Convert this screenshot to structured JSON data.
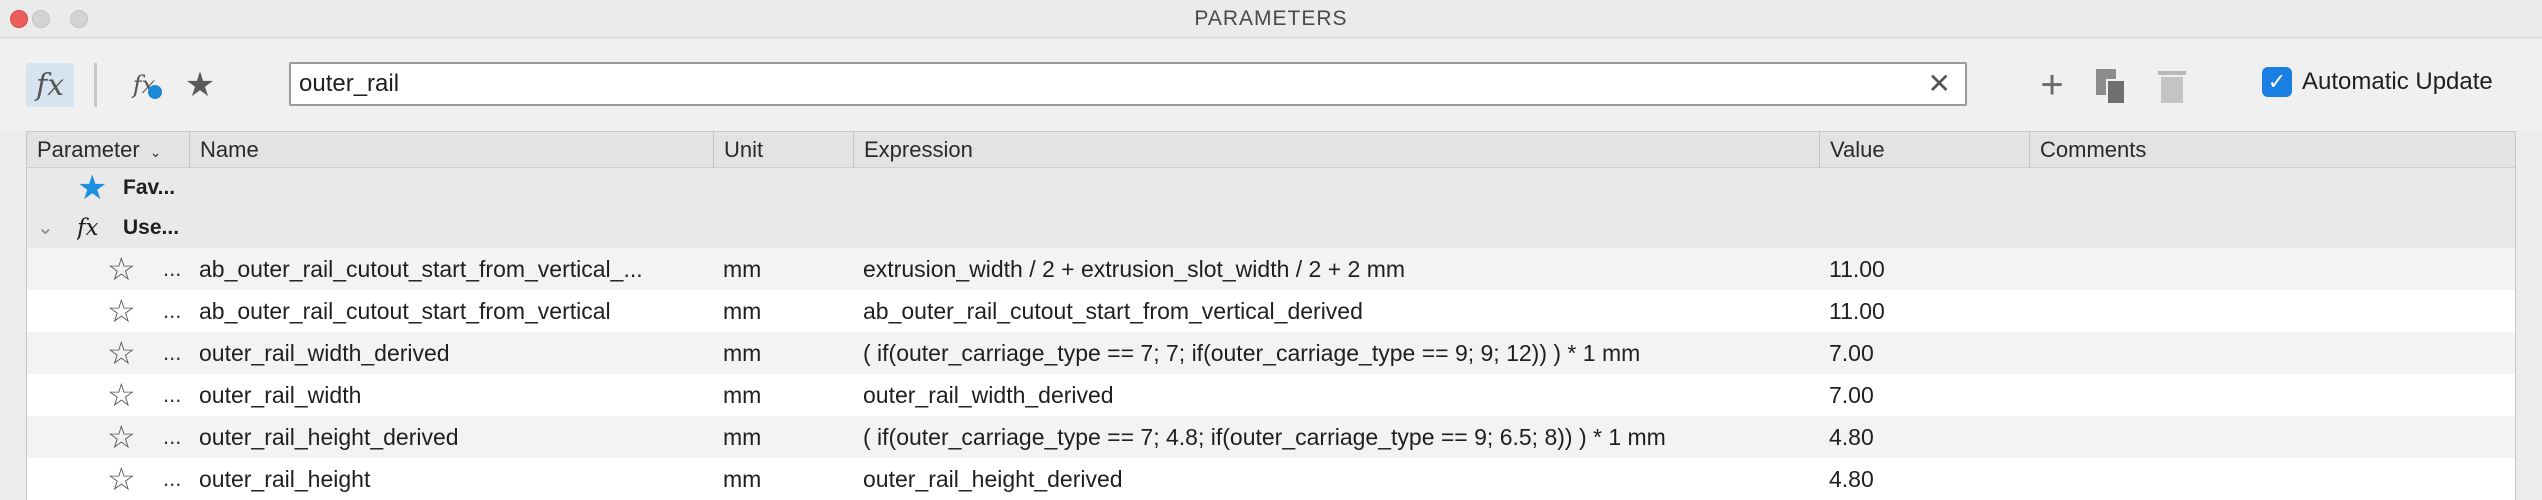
{
  "window": {
    "title": "PARAMETERS"
  },
  "toolbar": {
    "filter_all_icon": "fx-icon",
    "filter_user_icon": "user-fx-icon",
    "favorites_icon": "star-icon",
    "search": {
      "value": "outer_rail",
      "clear_icon": "close-icon"
    },
    "add_icon": "plus-icon",
    "copy_icon": "copy-icon",
    "delete_icon": "trash-icon",
    "auto_update": {
      "label": "Automatic Update",
      "checked": true
    }
  },
  "table": {
    "columns": {
      "parameter": "Parameter",
      "name": "Name",
      "unit": "Unit",
      "expression": "Expression",
      "value": "Value",
      "comments": "Comments"
    },
    "groups": {
      "favorites": "Fav...",
      "user": "Use..."
    },
    "rows": [
      {
        "dots": "...",
        "name": "ab_outer_rail_cutout_start_from_vertical_...",
        "unit": "mm",
        "expression": "extrusion_width / 2 + extrusion_slot_width / 2 + 2 mm",
        "value": "11.00",
        "comments": ""
      },
      {
        "dots": "...",
        "name": "ab_outer_rail_cutout_start_from_vertical",
        "unit": "mm",
        "expression": "ab_outer_rail_cutout_start_from_vertical_derived",
        "value": "11.00",
        "comments": ""
      },
      {
        "dots": "...",
        "name": "outer_rail_width_derived",
        "unit": "mm",
        "expression": "( if(outer_carriage_type == 7; 7; if(outer_carriage_type == 9; 9; 12)) ) * 1 mm",
        "value": "7.00",
        "comments": ""
      },
      {
        "dots": "...",
        "name": "outer_rail_width",
        "unit": "mm",
        "expression": "outer_rail_width_derived",
        "value": "7.00",
        "comments": ""
      },
      {
        "dots": "...",
        "name": "outer_rail_height_derived",
        "unit": "mm",
        "expression": "( if(outer_carriage_type == 7; 4.8; if(outer_carriage_type == 9; 6.5; 8)) ) * 1 mm",
        "value": "4.80",
        "comments": ""
      },
      {
        "dots": "...",
        "name": "outer_rail_height",
        "unit": "mm",
        "expression": "outer_rail_height_derived",
        "value": "4.80",
        "comments": ""
      }
    ]
  },
  "colors": {
    "accent": "#1a7fe3",
    "favorite_star": "#1e90e0",
    "close_button": "#ec5e59"
  }
}
